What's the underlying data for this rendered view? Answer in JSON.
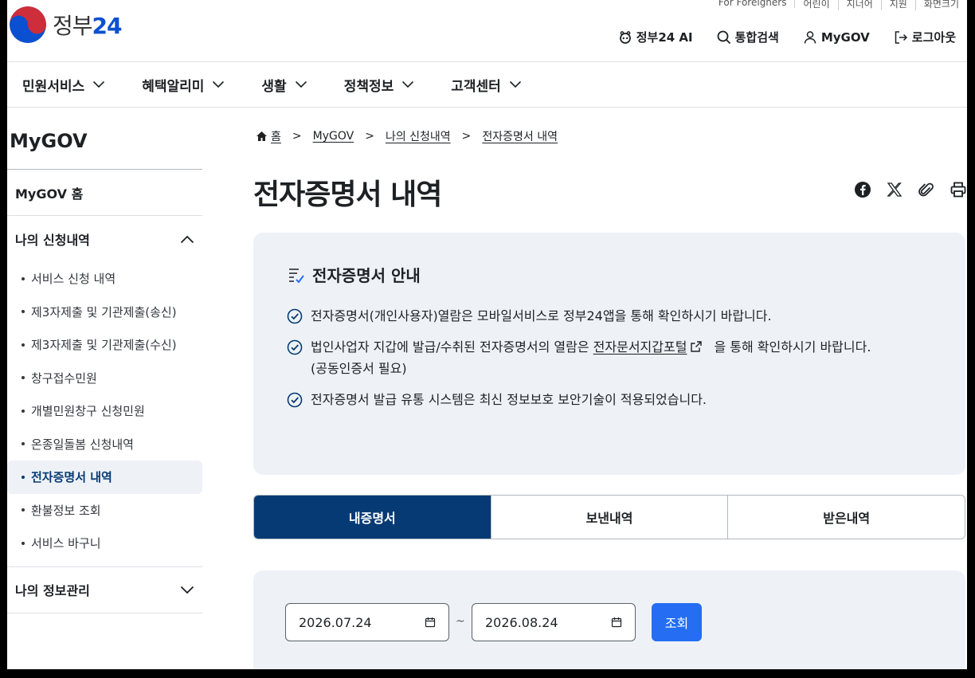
{
  "logo": {
    "text_main": "정부",
    "text_num": "24"
  },
  "util": [
    "For Foreigners",
    "어린이",
    "지너어",
    "지원",
    "화면크기"
  ],
  "header_actions": [
    {
      "label": "정부24 AI",
      "icon": "robot-icon"
    },
    {
      "label": "통합검색",
      "icon": "search-icon"
    },
    {
      "label": "MyGOV",
      "icon": "user-icon"
    },
    {
      "label": "로그아웃",
      "icon": "logout-icon"
    }
  ],
  "nav": [
    "민원서비스",
    "혜택알리미",
    "생활",
    "정책정보",
    "고객센터"
  ],
  "sidebar": {
    "title": "MyGOV",
    "home": "MyGOV 홈",
    "section1": "나의 신청내역",
    "items": [
      "서비스 신청 내역",
      "제3자제출 및 기관제출(송신)",
      "제3자제출 및 기관제출(수신)",
      "창구접수민원",
      "개별민원창구 신청민원",
      "온종일돌봄 신청내역",
      "전자증명서 내역",
      "환불정보 조회",
      "서비스 바구니"
    ],
    "active_index": 6,
    "section2": "나의 정보관리"
  },
  "breadcrumb": [
    "홈",
    "MyGOV",
    "나의 신청내역",
    "전자증명서 내역"
  ],
  "page_title": "전자증명서 내역",
  "info": {
    "title": "전자증명서 안내",
    "line1": "전자증명서(개인사용자)열람은 모바일서비스로 정부24앱을 통해 확인하시기 바랍니다.",
    "line2a": "법인사업자 지갑에 발급/수취된 전자증명서의 열람은 ",
    "line2link": "전자문서지갑포털",
    "line2b": "을 통해 확인하시기 바랍니다.",
    "line2c": "(공동인증서 필요)",
    "line3": "전자증명서 발급 유통 시스템은 최신 정보보호 보안기술이 적용되었습니다."
  },
  "tabs": [
    "내증명서",
    "보낸내역",
    "받은내역"
  ],
  "search": {
    "from": "2026.07.24",
    "sep": "~",
    "to": "2026.08.24",
    "button": "조회"
  },
  "colors": {
    "primary": "#063a74",
    "accent": "#256ef4",
    "panel": "#eef2f7"
  }
}
